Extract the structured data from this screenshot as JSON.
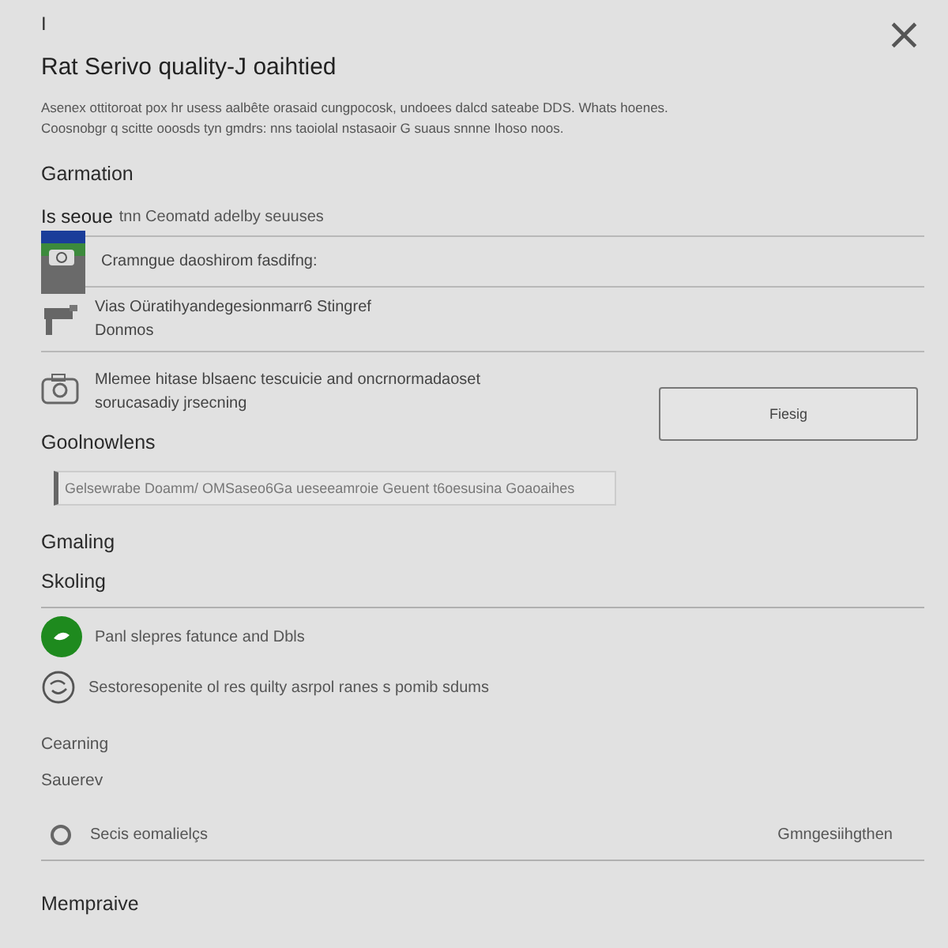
{
  "top_mark": "I",
  "close": "×",
  "title": "Rat Serivo quality-J oaihtied",
  "description": [
    "Asenex ottitoroat pox hr usess aalbête orasaid cungpocosk, undoees dalcd sateabe DDS. Whats hoenes.",
    "Coosnobgr q scitte ooosds tyn gmdrs: nns taoiolal nstasaoir G suaus snnne Ihoso noos."
  ],
  "section": "Garmation",
  "sub_heading": {
    "strong": "Is seoue",
    "rest": "tnn Ceomatd adelby seuuses"
  },
  "rows": [
    {
      "kind": "card",
      "lines": [
        "Cramngue daoshirom fasdifng:"
      ]
    },
    {
      "kind": "tool",
      "lines": [
        "Vias Oüratihyandegesionmarr6 Stingref",
        "Donmos"
      ]
    },
    {
      "kind": "camera",
      "lines": [
        "Mlemee hitase blsaenc tescuicie and oncrnormadaoset",
        "sorucasadiy jrsecning"
      ],
      "button": "Fiesig"
    }
  ],
  "field_section": "Goolnowlens",
  "field": {
    "placeholder": "Gelsewrabe Doamm/ OMSaseo6Ga ueseeamroie Geuent t6oesusina Goaoaihes"
  },
  "headings": [
    "Gmaling",
    "Skoling"
  ],
  "features": [
    {
      "kind": "leaf",
      "text": "Panl slepres fatunce and Dbls"
    },
    {
      "kind": "swirl",
      "text": "Sestoresopenite ol res quilty asrpol ranes s pomib sdums"
    }
  ],
  "cleaning": "Cearning",
  "cleaning_sub": "Sauerev",
  "option": {
    "label": "Secis eomalielçs",
    "value": "Gmngesiihgthen",
    "selected": false
  },
  "footer_heading": "Mempraive"
}
